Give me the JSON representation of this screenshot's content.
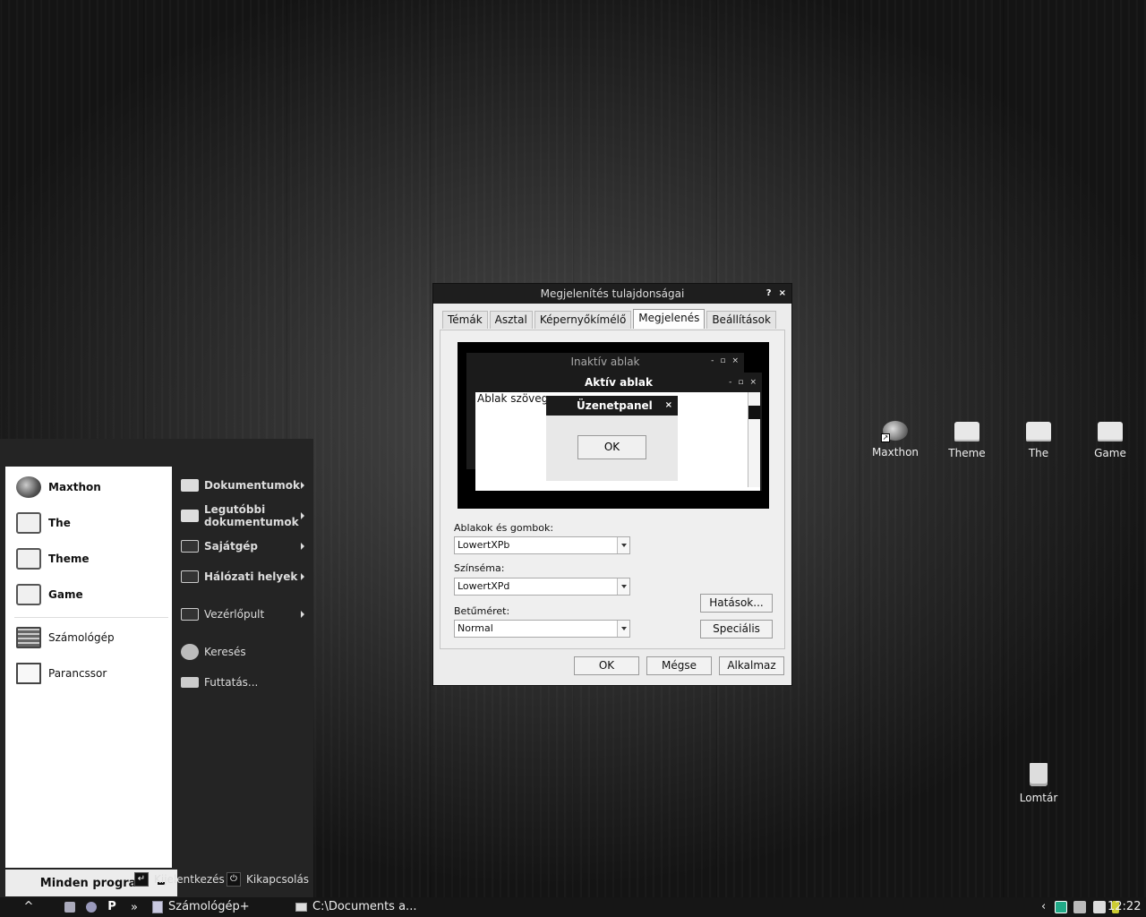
{
  "desktop": {
    "icons": [
      {
        "label": "Maxthon",
        "icon": "browser-shortcut-icon"
      },
      {
        "label": "Theme",
        "icon": "folder-icon"
      },
      {
        "label": "The",
        "icon": "folder-icon"
      },
      {
        "label": "Game",
        "icon": "folder-icon"
      },
      {
        "label": "Lomtár",
        "icon": "recycle-bin-icon"
      }
    ]
  },
  "start_menu": {
    "pinned": [
      {
        "label": "Maxthon",
        "icon": "globe-icon"
      },
      {
        "label": "The",
        "icon": "folder-icon"
      },
      {
        "label": "Theme",
        "icon": "folder-icon"
      },
      {
        "label": "Game",
        "icon": "folder-icon"
      }
    ],
    "recent": [
      {
        "label": "Számológép",
        "icon": "calculator-icon"
      },
      {
        "label": "Parancssor",
        "icon": "command-prompt-icon"
      }
    ],
    "all_programs": "Minden program",
    "places": [
      {
        "label": "Dokumentumok",
        "icon": "folder-icon"
      },
      {
        "label": "Legutóbbi dokumentumok",
        "icon": "folder-icon"
      },
      {
        "label": "Sajátgép",
        "icon": "computer-icon"
      },
      {
        "label": "Hálózati helyek",
        "icon": "network-icon"
      },
      {
        "label": "Vezérlőpult",
        "icon": "control-panel-icon"
      },
      {
        "label": "Keresés",
        "icon": "search-icon"
      },
      {
        "label": "Futtatás...",
        "icon": "run-icon"
      }
    ],
    "logoff": "Kijelentkezés",
    "shutdown": "Kikapcsolás"
  },
  "dialog": {
    "title": "Megjelenítés tulajdonságai",
    "title_buttons": [
      "?",
      "×"
    ],
    "tabs": [
      "Témák",
      "Asztal",
      "Képernyőkímélő",
      "Megjelenés",
      "Beállítások"
    ],
    "active_tab": "Megjelenés",
    "preview": {
      "inactive_title": "Inaktív ablak",
      "active_title": "Aktív ablak",
      "window_text": "Ablak szövege",
      "message_title": "Üzenetpanel",
      "ok": "OK",
      "win_buttons": [
        "-",
        "▫",
        "×"
      ]
    },
    "windows_buttons_label": "Ablakok és gombok:",
    "windows_buttons_value": "LowertXPb",
    "color_scheme_label": "Színséma:",
    "color_scheme_value": "LowertXPd",
    "font_size_label": "Betűméret:",
    "font_size_value": "Normal",
    "effects_button": "Hatások...",
    "advanced_button": "Speciális",
    "ok_button": "OK",
    "cancel_button": "Mégse",
    "apply_button": "Alkalmaz"
  },
  "taskbar": {
    "quick_launch_more": "»",
    "tasks": [
      {
        "label": "Számológép+",
        "icon": "calculator-icon"
      },
      {
        "label": "C:\\Documents a...",
        "icon": "folder-icon"
      }
    ],
    "tray_expand": "‹",
    "clock": "12:22"
  }
}
